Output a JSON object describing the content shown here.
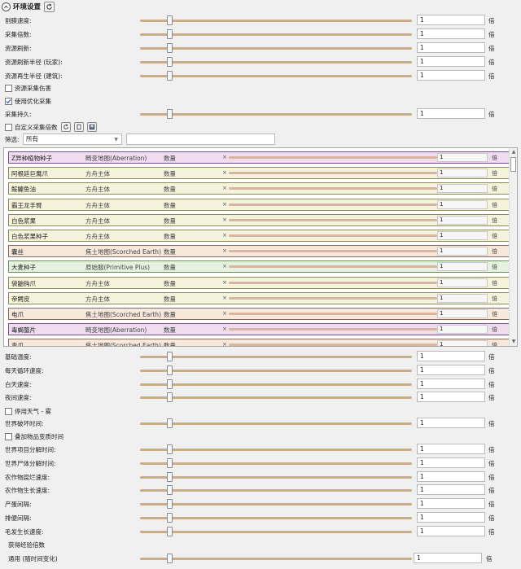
{
  "header": {
    "title": "环境设置",
    "collapse_icon": "chevron-up-icon",
    "refresh_icon": "refresh-icon"
  },
  "top_settings": [
    {
      "label": "割膜速度:",
      "value": "1",
      "unit": "倍",
      "level": 0.11
    },
    {
      "label": "采集倍数:",
      "value": "1",
      "unit": "倍",
      "level": 0.11
    },
    {
      "label": "资源刷新:",
      "value": "1",
      "unit": "倍",
      "level": 0.11
    },
    {
      "label": "资源刷新半径 (玩家):",
      "value": "1",
      "unit": "倍",
      "level": 0.11
    },
    {
      "label": "资源再生半径 (建筑):",
      "value": "1",
      "unit": "倍",
      "level": 0.11
    }
  ],
  "resource_damage": {
    "label": "资源采集伤害",
    "checked": false
  },
  "optimized_harvest": {
    "label": "使用优化采集",
    "checked": true
  },
  "harvest_durability": {
    "label": "采集持久:",
    "value": "1",
    "unit": "倍",
    "level": 0.11
  },
  "custom_multiplier": {
    "label": "自定义采集倍数",
    "checked": false
  },
  "filter": {
    "label": "筛选:",
    "selected": "所有"
  },
  "items": [
    {
      "name": "Z异种植物种子",
      "source": "畸变地图(Aberration)",
      "qty": "数量",
      "x": "×",
      "value": "1",
      "unit": "倍",
      "color": "#efdcef",
      "border": "#7a4d8a"
    },
    {
      "name": "阿根廷巨鹰爪",
      "source": "方舟主体",
      "qty": "数量",
      "x": "×",
      "value": "1",
      "unit": "倍",
      "color": "#f4f4dc",
      "border": "#8a8a5a"
    },
    {
      "name": "鮟鱇鱼油",
      "source": "方舟主体",
      "qty": "数量",
      "x": "×",
      "value": "1",
      "unit": "倍",
      "color": "#f4f4dc",
      "border": "#8a8a5a"
    },
    {
      "name": "霸王龙手臂",
      "source": "方舟主体",
      "qty": "数量",
      "x": "×",
      "value": "1",
      "unit": "倍",
      "color": "#f4f4dc",
      "border": "#8a8a5a"
    },
    {
      "name": "白色浆果",
      "source": "方舟主体",
      "qty": "数量",
      "x": "×",
      "value": "1",
      "unit": "倍",
      "color": "#f4f4dc",
      "border": "#8a8a5a"
    },
    {
      "name": "白色浆果种子",
      "source": "方舟主体",
      "qty": "数量",
      "x": "×",
      "value": "1",
      "unit": "倍",
      "color": "#f4f4dc",
      "border": "#8a8a5a"
    },
    {
      "name": "囊丝",
      "source": "焦土地图(Scorched Earth)",
      "qty": "数量",
      "x": "×",
      "value": "1",
      "unit": "倍",
      "color": "#f7e8dc",
      "border": "#8a6a5a"
    },
    {
      "name": "大麦种子",
      "source": "原始服(Primitive Plus)",
      "qty": "数量",
      "x": "×",
      "value": "1",
      "unit": "倍",
      "color": "#e6f2e0",
      "border": "#6a8a5a"
    },
    {
      "name": "袋鼬钩爪",
      "source": "方舟主体",
      "qty": "数量",
      "x": "×",
      "value": "1",
      "unit": "倍",
      "color": "#f4f4dc",
      "border": "#8a8a5a"
    },
    {
      "name": "帝鳄皮",
      "source": "方舟主体",
      "qty": "数量",
      "x": "×",
      "value": "1",
      "unit": "倍",
      "color": "#f4f4dc",
      "border": "#8a8a5a"
    },
    {
      "name": "电爪",
      "source": "焦土地图(Scorched Earth)",
      "qty": "数量",
      "x": "×",
      "value": "1",
      "unit": "倍",
      "color": "#f7e8dc",
      "border": "#8a6a5a"
    },
    {
      "name": "毒蝎螯片",
      "source": "畸变地图(Aberration)",
      "qty": "数量",
      "x": "×",
      "value": "1",
      "unit": "倍",
      "color": "#efdcef",
      "border": "#7a4d8a"
    },
    {
      "name": "毒爪",
      "source": "焦土地图(Scorched Earth)",
      "qty": "数量",
      "x": "×",
      "value": "1",
      "unit": "倍",
      "color": "#f7e8dc",
      "border": "#8a6a5a"
    }
  ],
  "bottom_settings_a": [
    {
      "label": "基础温度:",
      "value": "1",
      "unit": "倍",
      "level": 0.11
    },
    {
      "label": "每天循环速度:",
      "value": "1",
      "unit": "倍",
      "level": 0.11
    },
    {
      "label": "白天速度:",
      "value": "1",
      "unit": "倍",
      "level": 0.11
    },
    {
      "label": "夜间速度:",
      "value": "1",
      "unit": "倍",
      "level": 0.11
    }
  ],
  "disable_weather": {
    "label": "停用天气 - 雾",
    "checked": false
  },
  "world_breach": {
    "label": "世界破坏时间:",
    "value": "1",
    "unit": "倍",
    "level": 0.11
  },
  "item_decay": {
    "label": "叠加物品变质时间",
    "checked": false
  },
  "bottom_settings_b": [
    {
      "label": "世界项目分解时间:",
      "value": "1",
      "unit": "倍",
      "level": 0.11
    },
    {
      "label": "世界尸体分解时间:",
      "value": "1",
      "unit": "倍",
      "level": 0.11
    },
    {
      "label": "农作物腐烂速度:",
      "value": "1",
      "unit": "倍",
      "level": 0.11
    },
    {
      "label": "农作物生长速度:",
      "value": "1",
      "unit": "倍",
      "level": 0.11
    },
    {
      "label": "产蛋间隔:",
      "value": "1",
      "unit": "倍",
      "level": 0.11
    },
    {
      "label": "排便间隔:",
      "value": "1",
      "unit": "倍",
      "level": 0.11
    },
    {
      "label": "毛发生长速度:",
      "value": "1",
      "unit": "倍",
      "level": 0.11
    }
  ],
  "xp_section": {
    "title": "获得经验倍数"
  },
  "xp_general": {
    "label": "通用 (随时间变化)",
    "value": "1",
    "unit": "倍",
    "level": 0.11
  }
}
